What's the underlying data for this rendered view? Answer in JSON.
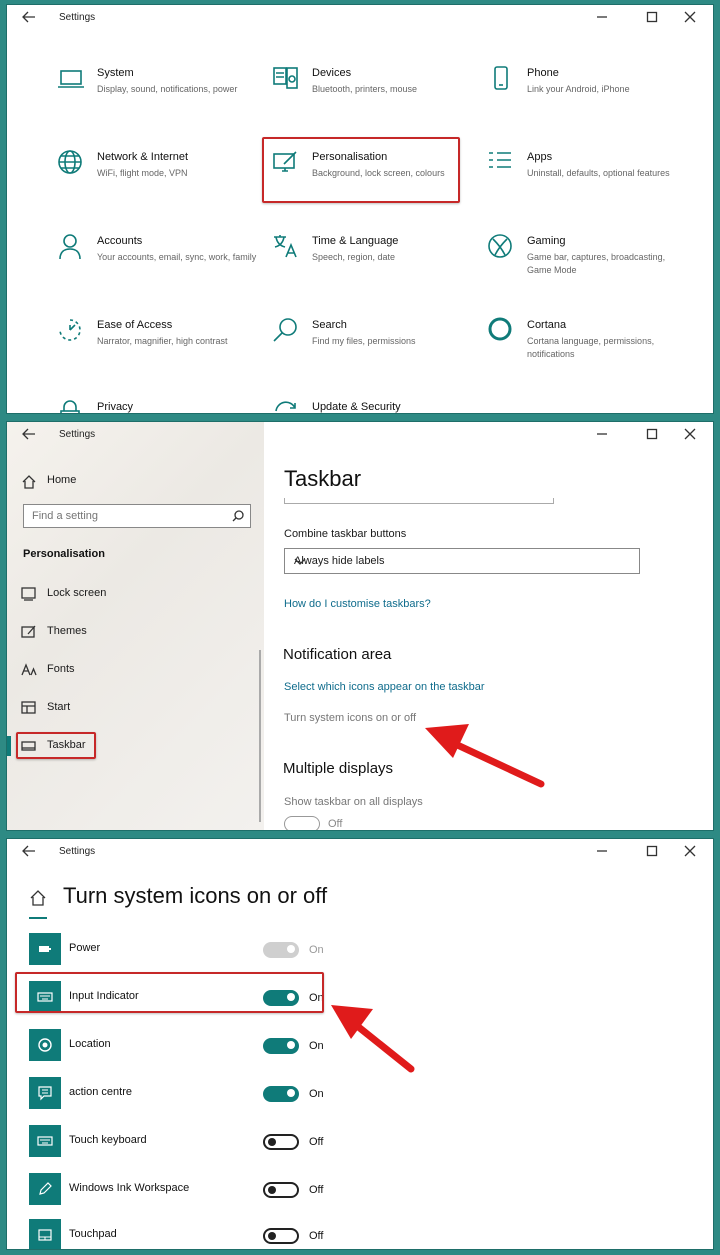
{
  "window_title": "Settings",
  "panel1": {
    "tiles": [
      {
        "name": "System",
        "desc": "Display, sound, notifications, power",
        "icon": "laptop-icon"
      },
      {
        "name": "Devices",
        "desc": "Bluetooth, printers, mouse",
        "icon": "keyboard-speaker-icon"
      },
      {
        "name": "Phone",
        "desc": "Link your Android, iPhone",
        "icon": "phone-icon"
      },
      {
        "name": "Network & Internet",
        "desc": "WiFi, flight mode, VPN",
        "icon": "globe-icon"
      },
      {
        "name": "Personalisation",
        "desc": "Background, lock screen, colours",
        "icon": "paintbrush-monitor-icon"
      },
      {
        "name": "Apps",
        "desc": "Uninstall, defaults, optional features",
        "icon": "apps-list-icon"
      },
      {
        "name": "Accounts",
        "desc": "Your accounts, email, sync, work, family",
        "icon": "person-icon"
      },
      {
        "name": "Time & Language",
        "desc": "Speech, region, date",
        "icon": "language-icon"
      },
      {
        "name": "Gaming",
        "desc": "Game bar, captures, broadcasting, Game Mode",
        "icon": "xbox-icon"
      },
      {
        "name": "Ease of Access",
        "desc": "Narrator, magnifier, high contrast",
        "icon": "ease-of-access-icon"
      },
      {
        "name": "Search",
        "desc": "Find my files, permissions",
        "icon": "search-icon"
      },
      {
        "name": "Cortana",
        "desc": "Cortana language, permissions, notifications",
        "icon": "cortana-ring-icon"
      },
      {
        "name": "Privacy",
        "desc": "",
        "icon": "lock-icon"
      },
      {
        "name": "Update & Security",
        "desc": "",
        "icon": "refresh-icon"
      }
    ]
  },
  "panel2": {
    "home_label": "Home",
    "search_placeholder": "Find a setting",
    "section_label": "Personalisation",
    "nav": [
      {
        "label": "Lock screen",
        "icon": "lock-screen-icon"
      },
      {
        "label": "Themes",
        "icon": "themes-icon"
      },
      {
        "label": "Fonts",
        "icon": "fonts-icon"
      },
      {
        "label": "Start",
        "icon": "start-icon"
      },
      {
        "label": "Taskbar",
        "icon": "taskbar-icon"
      }
    ],
    "page_title": "Taskbar",
    "combine_label": "Combine taskbar buttons",
    "combine_value": "Always hide labels",
    "customise_link": "How do I customise taskbars?",
    "notification_heading": "Notification area",
    "select_icons_link": "Select which icons appear on the taskbar",
    "system_icons_link": "Turn system icons on or off",
    "multiple_heading": "Multiple displays",
    "show_all_label": "Show taskbar on all displays",
    "show_all_value": "Off"
  },
  "panel3": {
    "page_title": "Turn system icons on or off",
    "rows": [
      {
        "label": "Power",
        "state": "On",
        "mode": "disabled",
        "icon": "battery-icon"
      },
      {
        "label": "Input Indicator",
        "state": "On",
        "mode": "on",
        "icon": "keyboard-icon"
      },
      {
        "label": "Location",
        "state": "On",
        "mode": "on",
        "icon": "location-icon"
      },
      {
        "label": "action centre",
        "state": "On",
        "mode": "on",
        "icon": "action-centre-icon"
      },
      {
        "label": "Touch keyboard",
        "state": "Off",
        "mode": "off",
        "icon": "keyboard-icon"
      },
      {
        "label": "Windows Ink Workspace",
        "state": "Off",
        "mode": "off",
        "icon": "pen-icon"
      },
      {
        "label": "Touchpad",
        "state": "Off",
        "mode": "off",
        "icon": "touchpad-icon"
      }
    ]
  },
  "colors": {
    "accent": "#0f7b79",
    "highlight": "#c62828",
    "arrow": "#e01b1b",
    "frame": "#2e8a84"
  }
}
